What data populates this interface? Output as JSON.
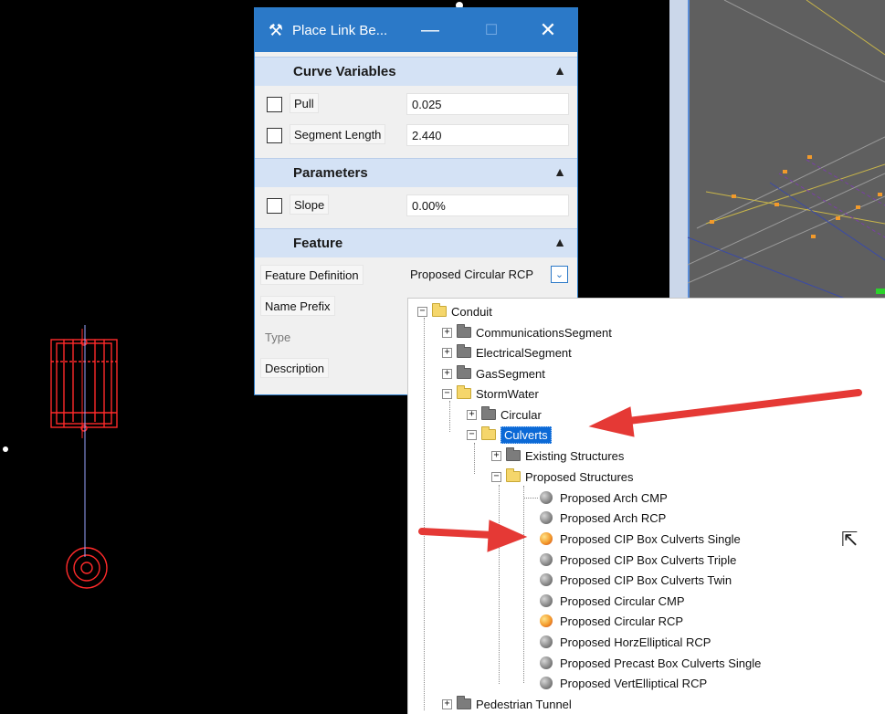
{
  "dialog": {
    "title": "Place Link Be...",
    "sections": {
      "curve_variables": {
        "title": "Curve Variables",
        "rows": [
          {
            "label": "Pull",
            "value": "0.025"
          },
          {
            "label": "Segment Length",
            "value": "2.440"
          }
        ]
      },
      "parameters": {
        "title": "Parameters",
        "rows": [
          {
            "label": "Slope",
            "value": "0.00%"
          }
        ]
      },
      "feature": {
        "title": "Feature",
        "feature_definition_label": "Feature Definition",
        "feature_definition_value": "Proposed Circular RCP",
        "name_prefix_label": "Name Prefix",
        "type_label": "Type",
        "description_label": "Description"
      }
    },
    "icons": {
      "app": "tool-icon",
      "minimize": "minimize-icon",
      "maximize": "maximize-icon",
      "close": "close-icon",
      "collapse": "chevron-up-icon",
      "dropdown": "chevron-down-icon"
    }
  },
  "tree": {
    "root": "Conduit",
    "items": [
      {
        "label": "CommunicationsSegment"
      },
      {
        "label": "ElectricalSegment"
      },
      {
        "label": "GasSegment"
      },
      {
        "label": "StormWater"
      },
      {
        "label": "Circular"
      },
      {
        "label": "Culverts"
      },
      {
        "label": "Existing Structures"
      },
      {
        "label": "Proposed Structures"
      },
      {
        "label": "Proposed Arch CMP"
      },
      {
        "label": "Proposed Arch RCP"
      },
      {
        "label": "Proposed CIP Box Culverts Single"
      },
      {
        "label": "Proposed CIP Box Culverts Triple"
      },
      {
        "label": "Proposed CIP Box Culverts Twin"
      },
      {
        "label": "Proposed Circular CMP"
      },
      {
        "label": "Proposed Circular RCP"
      },
      {
        "label": "Proposed HorzElliptical RCP"
      },
      {
        "label": "Proposed Precast Box Culverts Single"
      },
      {
        "label": "Proposed VertElliptical RCP"
      },
      {
        "label": "Pedestrian Tunnel"
      }
    ]
  },
  "colors": {
    "titlebar": "#2b79c8",
    "section_header": "#d4e2f5",
    "selection": "#0b69d6",
    "annotation_arrow": "#e53935",
    "cad_background": "#000000",
    "cad_lines": "#ff2a2a"
  }
}
